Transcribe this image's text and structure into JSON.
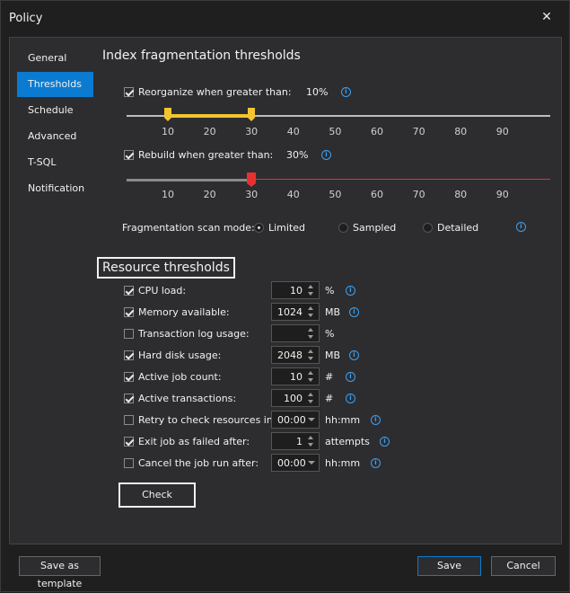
{
  "window": {
    "title": "Policy"
  },
  "nav": {
    "items": [
      "General",
      "Thresholds",
      "Schedule",
      "Advanced",
      "T-SQL",
      "Notification"
    ],
    "active": "Thresholds"
  },
  "index": {
    "title": "Index fragmentation thresholds",
    "reorganize": {
      "label": "Reorganize when greater than:",
      "value": "10%",
      "checked": true,
      "range_low": 10,
      "range_high": 30,
      "slider_color": "#f4c430"
    },
    "rebuild": {
      "label": "Rebuild when greater than:",
      "value": "30%",
      "checked": true,
      "thumb": 30,
      "slider_color": "#e8312f"
    },
    "ticks": [
      "10",
      "20",
      "30",
      "40",
      "50",
      "60",
      "70",
      "80",
      "90"
    ],
    "scan_mode": {
      "label": "Fragmentation scan mode:",
      "options": [
        "Limited",
        "Sampled",
        "Detailed"
      ],
      "selected": "Limited"
    }
  },
  "resource": {
    "title": "Resource thresholds",
    "rows": [
      {
        "label": "CPU load:",
        "checked": true,
        "value": "10",
        "unit": "%",
        "control": "spin"
      },
      {
        "label": "Memory available:",
        "checked": true,
        "value": "1024",
        "unit": "MB",
        "control": "spin"
      },
      {
        "label": "Transaction log usage:",
        "checked": false,
        "value": "",
        "unit": "%",
        "control": "spin"
      },
      {
        "label": "Hard disk usage:",
        "checked": true,
        "value": "2048",
        "unit": "MB",
        "control": "spin"
      },
      {
        "label": "Active job count:",
        "checked": true,
        "value": "10",
        "unit": "#",
        "control": "spin"
      },
      {
        "label": "Active transactions:",
        "checked": true,
        "value": "100",
        "unit": "#",
        "control": "spin"
      },
      {
        "label": "Retry to check resources in:",
        "checked": false,
        "value": "00:00",
        "unit": "hh:mm",
        "control": "dropdown"
      },
      {
        "label": "Exit job as failed after:",
        "checked": true,
        "value": "1",
        "unit": "attempts",
        "control": "spin"
      },
      {
        "label": "Cancel the job run after:",
        "checked": false,
        "value": "00:00",
        "unit": "hh:mm",
        "control": "dropdown"
      }
    ],
    "check_label": "Check"
  },
  "footer": {
    "template_label": "Save as template",
    "save_label": "Save",
    "cancel_label": "Cancel"
  },
  "colors": {
    "accent": "#0a7bd0",
    "info": "#3ca0f0"
  }
}
